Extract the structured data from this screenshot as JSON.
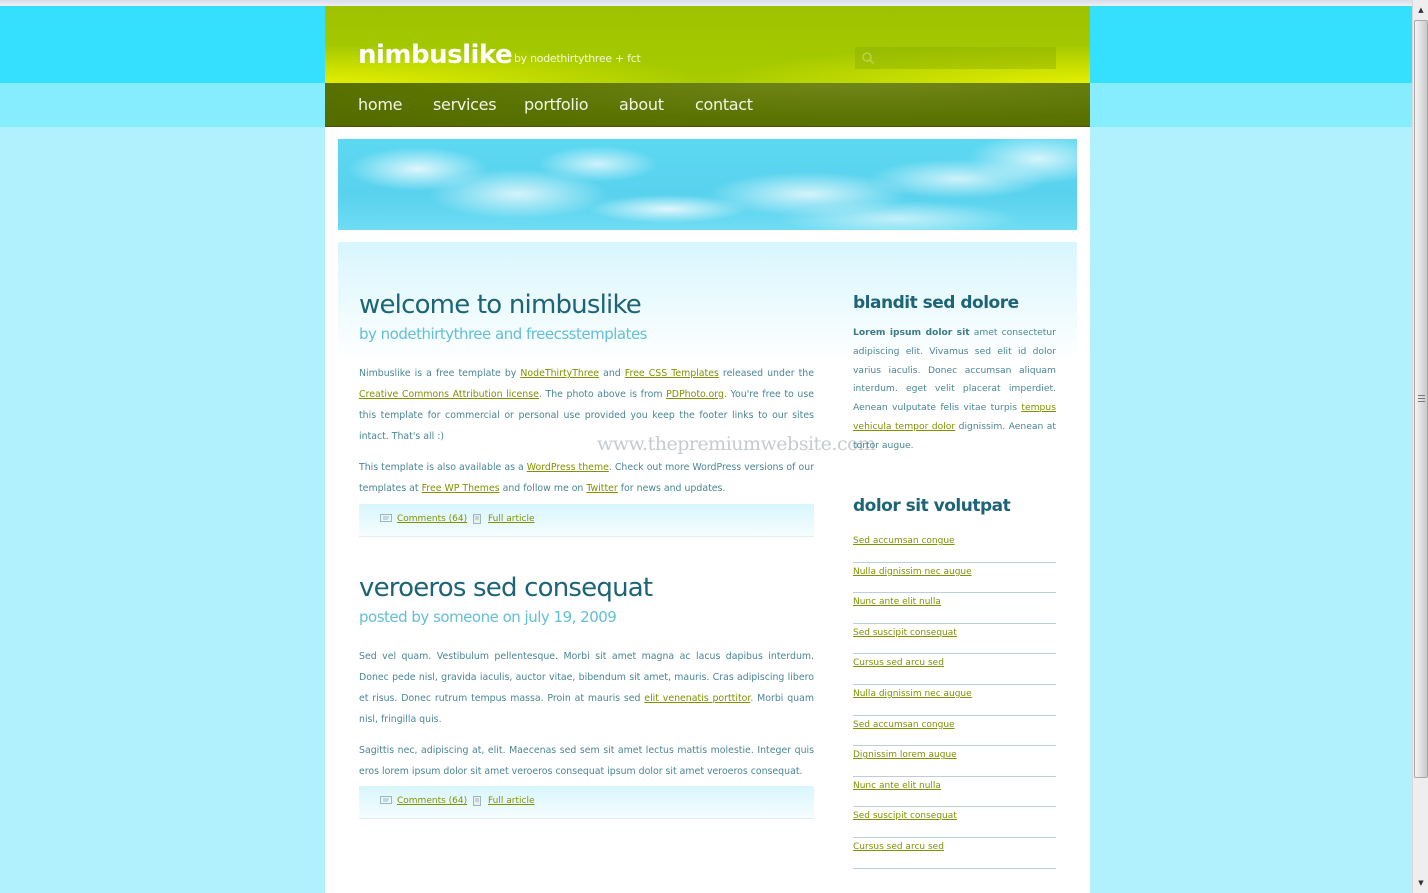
{
  "site": {
    "logo": "nimbuslike",
    "tagline": "by nodethirtythree + fct",
    "search": {
      "placeholder": "",
      "value": ""
    }
  },
  "nav": {
    "items": [
      {
        "label": "home"
      },
      {
        "label": "services"
      },
      {
        "label": "portfolio"
      },
      {
        "label": "about"
      },
      {
        "label": "contact"
      }
    ]
  },
  "posts": [
    {
      "title": "welcome to nimbuslike",
      "subtitle": "by nodethirtythree and freecsstemplates",
      "p1": {
        "t1": "Nimbuslike is a free template by ",
        "l1": "NodeThirtyThree",
        "t2": " and ",
        "l2": "Free CSS Templates",
        "t3": " released under the ",
        "l3": "Creative Commons Attribution license",
        "t4": ". The photo above is from ",
        "l4": "PDPhoto.org",
        "t5": ". You're free to use this template for commercial or personal use provided you keep the footer links to our sites intact. That's all :)"
      },
      "p2": {
        "t1": "This template is also available as a ",
        "l1": "WordPress theme",
        "t2": ". Check out more WordPress versions of our templates at ",
        "l2": "Free WP Themes",
        "t3": " and follow me on ",
        "l3": "Twitter",
        "t4": " for news and updates."
      },
      "meta": {
        "comments": "Comments (64)",
        "full": "Full article"
      }
    },
    {
      "title": "veroeros sed consequat",
      "subtitle": "posted by someone on july 19, 2009",
      "p1": {
        "t1": "Sed vel quam. Vestibulum pellentesque. Morbi sit amet magna ac lacus dapibus interdum. Donec pede nisl, gravida iaculis, auctor vitae, bibendum sit amet, mauris. Cras adipiscing libero et risus. Donec rutrum tempus massa. Proin at mauris sed ",
        "l1": "elit venenatis porttitor",
        "t2": ". Morbi quam nisl, fringilla quis."
      },
      "p2": {
        "t1": "Sagittis nec, adipiscing at, elit. Maecenas sed sem sit amet lectus mattis molestie. Integer quis eros lorem ipsum dolor sit amet veroeros consequat ipsum dolor sit amet veroeros consequat."
      },
      "meta": {
        "comments": "Comments (64)",
        "full": "Full article"
      }
    }
  ],
  "watermark": "www.thepremiumwebsite.com",
  "sidebar": {
    "box1": {
      "title": "blandit sed dolore",
      "lead": "Lorem ipsum dolor sit",
      "t1": " amet consectetur adipiscing elit. Vivamus sed elit id dolor varius iaculis. Donec accumsan aliquam interdum. eget velit placerat imperdiet. Aenean vulputate felis vitae turpis ",
      "link": "tempus vehicula tempor dolor",
      "t2": " dignissim. Aenean at tortor augue."
    },
    "box2": {
      "title": "dolor sit volutpat",
      "links": [
        "Sed accumsan congue",
        "Nulla dignissim nec augue",
        "Nunc ante elit nulla",
        "Sed suscipit consequat",
        "Cursus sed arcu sed",
        "Nulla dignissim nec augue",
        "Sed accumsan congue",
        "Dignissim lorem augue",
        "Nunc ante elit nulla",
        "Sed suscipit consequat",
        "Cursus sed arcu sed"
      ]
    }
  },
  "colors": {
    "header_green": "#a8cc00",
    "nav_green": "#5a7300",
    "heading_teal": "#1d6476",
    "subtitle_blue": "#62bfd6",
    "link_olive": "#7f9300",
    "body_bg": "#b0f1fd"
  }
}
